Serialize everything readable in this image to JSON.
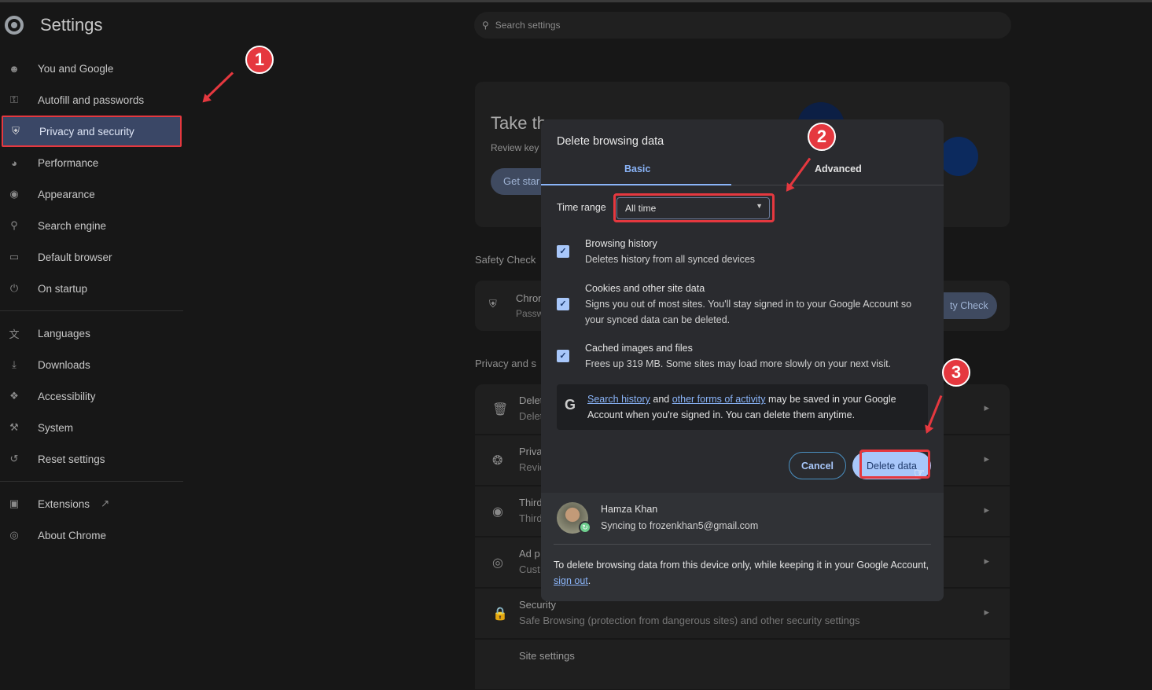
{
  "header": {
    "title": "Settings",
    "search_placeholder": "Search settings"
  },
  "sidebar": {
    "items": [
      {
        "label": "You and Google",
        "icon": "person-icon"
      },
      {
        "label": "Autofill and passwords",
        "icon": "key-icon"
      },
      {
        "label": "Privacy and security",
        "icon": "shield-icon",
        "active": true
      },
      {
        "label": "Performance",
        "icon": "gauge-icon"
      },
      {
        "label": "Appearance",
        "icon": "palette-icon"
      },
      {
        "label": "Search engine",
        "icon": "search-icon"
      },
      {
        "label": "Default browser",
        "icon": "browser-icon"
      },
      {
        "label": "On startup",
        "icon": "power-icon"
      },
      {
        "label": "Languages",
        "icon": "translate-icon"
      },
      {
        "label": "Downloads",
        "icon": "download-icon"
      },
      {
        "label": "Accessibility",
        "icon": "accessibility-icon"
      },
      {
        "label": "System",
        "icon": "wrench-icon"
      },
      {
        "label": "Reset settings",
        "icon": "reset-icon"
      },
      {
        "label": "Extensions",
        "icon": "puzzle-icon"
      },
      {
        "label": "About Chrome",
        "icon": "chrome-icon"
      }
    ]
  },
  "background": {
    "guide_title": "Take th",
    "guide_sub": "Review key",
    "guide_btn": "Get star",
    "safety_heading": "Safety Check",
    "safety_t1": "Chron",
    "safety_t2": "Passw",
    "safety_btn": "ty Check",
    "privacy_heading": "Privacy and s",
    "rows": [
      {
        "t1": "Delet",
        "t2": "Delet"
      },
      {
        "t1": "Priva",
        "t2": "Revie"
      },
      {
        "t1": "Third",
        "t2": "Third"
      },
      {
        "t1": "Ad p",
        "t2": "Cust"
      },
      {
        "t1": "Security",
        "t2": "Safe Browsing (protection from dangerous sites) and other security settings"
      },
      {
        "t1": "Site settings",
        "t2": ""
      }
    ]
  },
  "dialog": {
    "title": "Delete browsing data",
    "tabs": [
      "Basic",
      "Advanced"
    ],
    "time_range_label": "Time range",
    "time_range_value": "All time",
    "options": [
      {
        "title": "Browsing history",
        "desc": "Deletes history from all synced devices",
        "checked": true
      },
      {
        "title": "Cookies and other site data",
        "desc": "Signs you out of most sites. You'll stay signed in to your Google Account so your synced data can be deleted.",
        "checked": true
      },
      {
        "title": "Cached images and files",
        "desc": "Frees up 319 MB. Some sites may load more slowly on your next visit.",
        "checked": true
      }
    ],
    "info_link1": "Search history",
    "info_and": " and ",
    "info_link2": "other forms of activity",
    "info_rest": " may be saved in your Google Account when you're signed in. You can delete them anytime.",
    "cancel": "Cancel",
    "delete": "Delete data",
    "user_name": "Hamza Khan",
    "user_sync": "Syncing to frozenkhan5@gmail.com",
    "footer_text": "To delete browsing data from this device only, while keeping it in your Google Account, ",
    "footer_link": "sign out",
    "footer_end": "."
  },
  "annotations": [
    "1",
    "2",
    "3"
  ]
}
